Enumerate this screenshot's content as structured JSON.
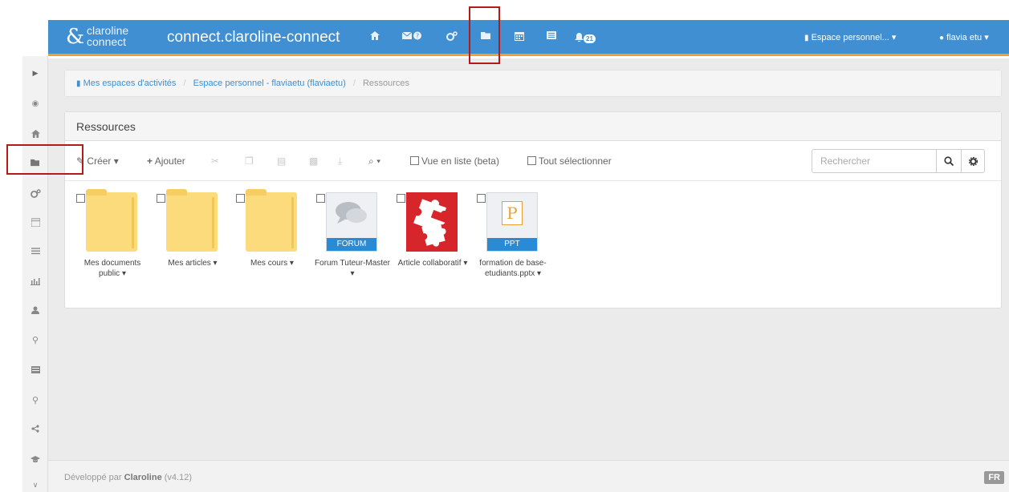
{
  "app": {
    "logo_top": "claroline",
    "logo_bottom": "connect",
    "site_title": "connect.claroline-connect"
  },
  "navbar": {
    "notification_count": "21",
    "workspace_menu": "Espace personnel... ▾",
    "user_menu": "flavia etu ▾"
  },
  "breadcrumb": {
    "items": [
      "Mes espaces d'activités",
      "Espace personnel - flaviaetu (flaviaetu)",
      "Ressources"
    ]
  },
  "panel": {
    "title": "Ressources"
  },
  "toolbar": {
    "create_label": "Créer ▾",
    "add_label": "Ajouter",
    "zoom_label": "▾",
    "list_view_label": "Vue en liste (beta)",
    "select_all_label": "Tout sélectionner",
    "search_placeholder": "Rechercher"
  },
  "resources": [
    {
      "name": "Mes documents public ▾",
      "kind": "folder"
    },
    {
      "name": "Mes articles ▾",
      "kind": "folder"
    },
    {
      "name": "Mes cours ▾",
      "kind": "folder"
    },
    {
      "name": "Forum Tuteur-Master ▾",
      "kind": "forum",
      "ribbon": "FORUM"
    },
    {
      "name": "Article collaboratif ▾",
      "kind": "puzzle"
    },
    {
      "name": "formation de base-etudiants.pptx ▾",
      "kind": "ppt",
      "ribbon": "PPT",
      "letter": "P"
    }
  ],
  "footer": {
    "prefix": "Développé par",
    "brand": "Claroline",
    "version": "(v4.12)",
    "lang": "FR"
  },
  "colors": {
    "navbar": "#3f8fd2",
    "accent_bar": "#f0a030",
    "link": "#3f8fd2",
    "folder": "#fbdb7c",
    "highlight": "#b31b1b"
  }
}
